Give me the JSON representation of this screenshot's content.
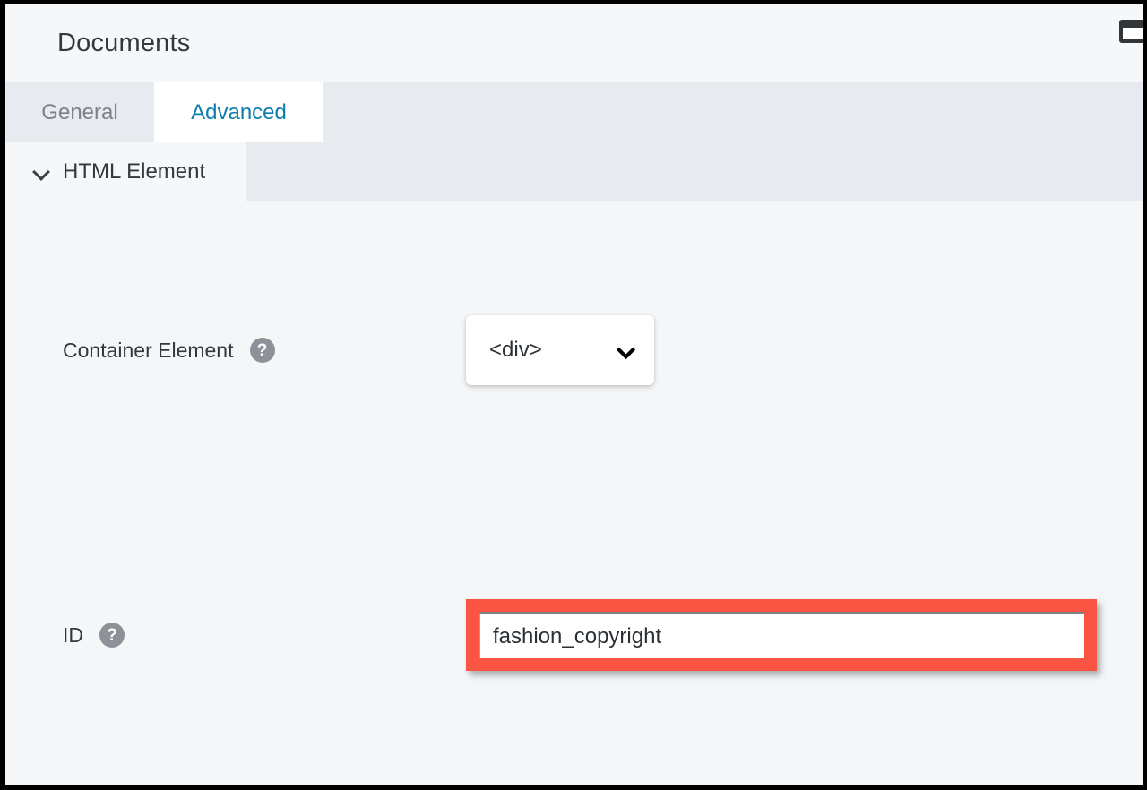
{
  "header": {
    "title": "Documents",
    "window_icon": "window-icon"
  },
  "tabs": [
    {
      "label": "General",
      "active": false
    },
    {
      "label": "Advanced",
      "active": true
    }
  ],
  "section": {
    "title": "HTML Element",
    "chevron": "chevron-down-icon",
    "expanded": true
  },
  "fields": {
    "container_element": {
      "label": "Container Element",
      "help": "?",
      "value": "<div>",
      "chevron": "chevron-down-icon"
    },
    "id": {
      "label": "ID",
      "help": "?",
      "value": "fashion_copyright",
      "placeholder": ""
    }
  },
  "colors": {
    "accent_blue": "#0d7eae",
    "highlight_red": "#fa5543",
    "page_bg": "#f4f6f8",
    "tabstrip_bg": "#e7eaef",
    "text_primary": "#33383d",
    "text_muted": "#7a8288"
  }
}
